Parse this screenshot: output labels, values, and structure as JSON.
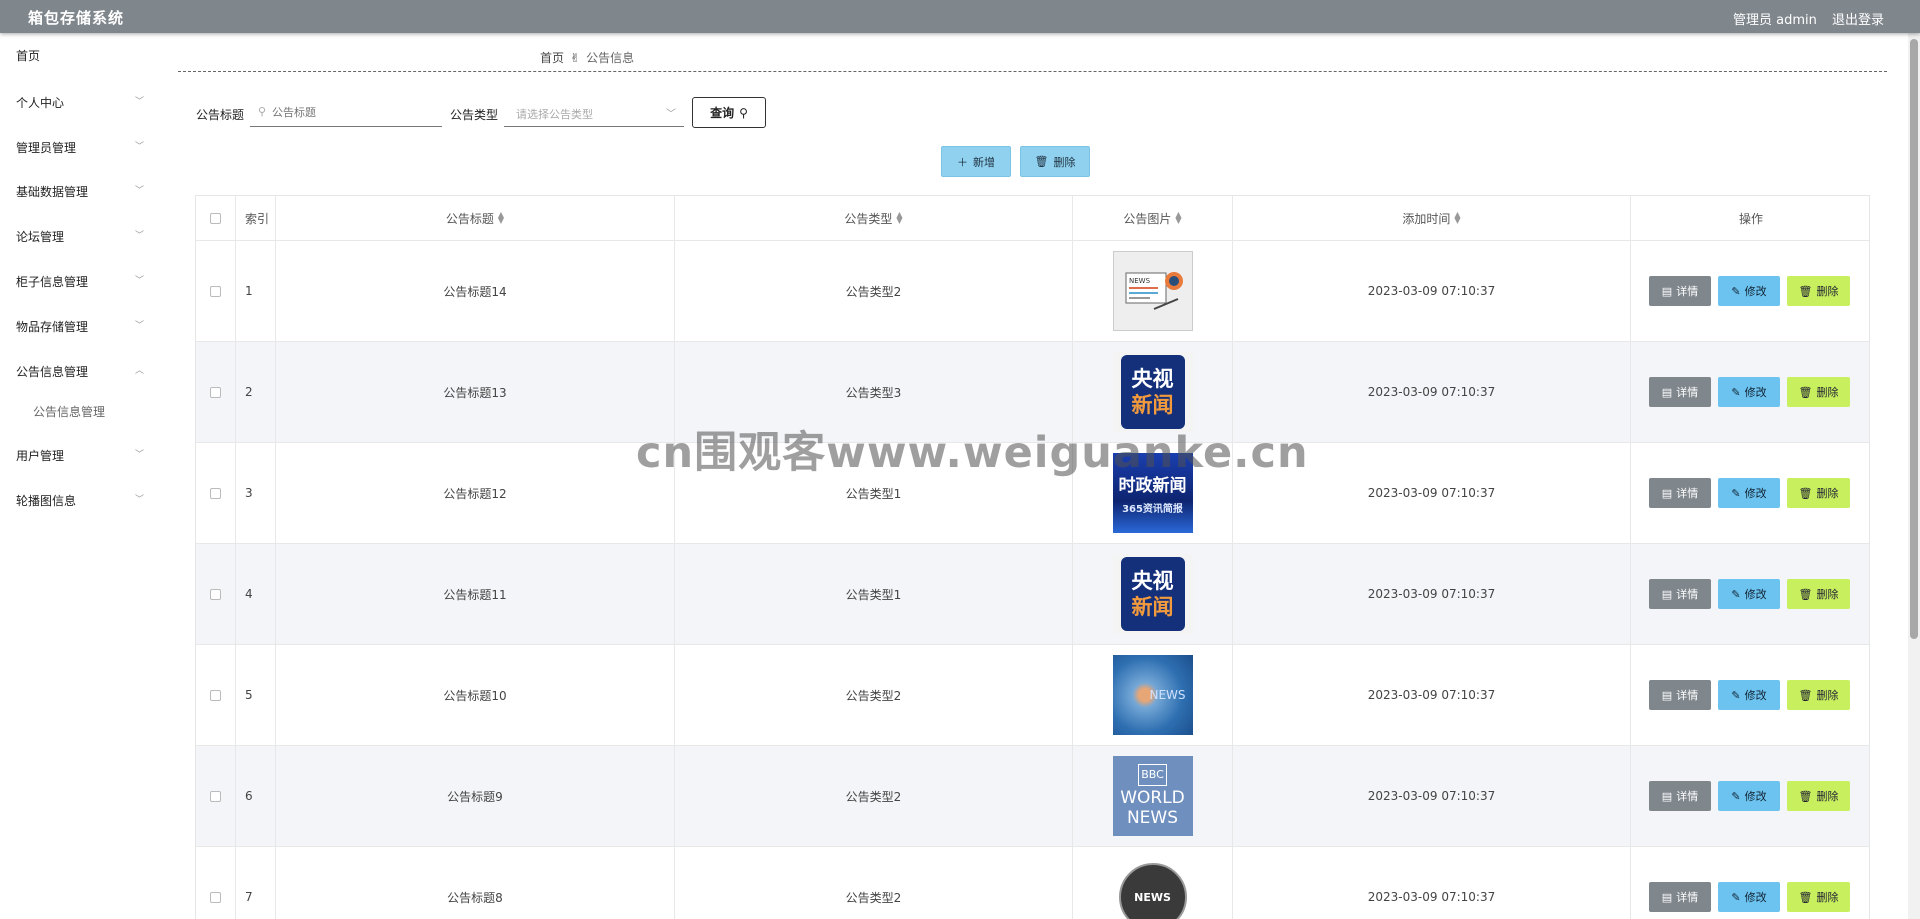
{
  "header": {
    "app_title": "箱包存储系统",
    "user_label": "管理员 admin",
    "logout_label": "退出登录"
  },
  "sidebar": {
    "items": [
      {
        "label": "首页",
        "has_chevron": false
      },
      {
        "label": "个人中心",
        "has_chevron": true
      },
      {
        "label": "管理员管理",
        "has_chevron": true
      },
      {
        "label": "基础数据管理",
        "has_chevron": true
      },
      {
        "label": "论坛管理",
        "has_chevron": true
      },
      {
        "label": "柜子信息管理",
        "has_chevron": true
      },
      {
        "label": "物品存储管理",
        "has_chevron": true
      },
      {
        "label": "公告信息管理",
        "has_chevron": true,
        "expanded": true
      },
      {
        "label": "用户管理",
        "has_chevron": true
      },
      {
        "label": "轮播图信息",
        "has_chevron": true
      }
    ],
    "subitem": "公告信息管理"
  },
  "breadcrumb": {
    "home": "首页",
    "current": "公告信息"
  },
  "search": {
    "title_label": "公告标题",
    "title_placeholder": "公告标题",
    "type_label": "公告类型",
    "type_placeholder": "请选择公告类型",
    "query_label": "查询"
  },
  "actions": {
    "add_label": "新增",
    "delete_label": "删除"
  },
  "table": {
    "columns": {
      "index": "索引",
      "title": "公告标题",
      "type": "公告类型",
      "image": "公告图片",
      "time": "添加时间",
      "ops": "操作"
    },
    "rows": [
      {
        "index": "1",
        "title": "公告标题14",
        "type": "公告类型2",
        "image": "news-paper-thumb",
        "time": "2023-03-09 07:10:37"
      },
      {
        "index": "2",
        "title": "公告标题13",
        "type": "公告类型3",
        "image": "cctv-news-thumb",
        "time": "2023-03-09 07:10:37"
      },
      {
        "index": "3",
        "title": "公告标题12",
        "type": "公告类型1",
        "image": "shizheng-news-thumb",
        "time": "2023-03-09 07:10:37"
      },
      {
        "index": "4",
        "title": "公告标题11",
        "type": "公告类型1",
        "image": "cctv-news-thumb",
        "time": "2023-03-09 07:10:37"
      },
      {
        "index": "5",
        "title": "公告标题10",
        "type": "公告类型2",
        "image": "blue-news-thumb",
        "time": "2023-03-09 07:10:37"
      },
      {
        "index": "6",
        "title": "公告标题9",
        "type": "公告类型2",
        "image": "bbc-world-news-thumb",
        "time": "2023-03-09 07:10:37"
      },
      {
        "index": "7",
        "title": "公告标题8",
        "type": "公告类型2",
        "image": "globe-news-thumb",
        "time": "2023-03-09 07:10:37"
      }
    ],
    "op_labels": {
      "detail": "详情",
      "edit": "修改",
      "delete": "删除"
    }
  },
  "thumb_text": {
    "cctv_top": "央视",
    "cctv_bottom": "新闻",
    "shizheng_main": "时政新闻",
    "shizheng_sub": "365资讯简报",
    "blue_news": "NEWS",
    "bbc_logo": "BBC",
    "bbc_world": "WORLD",
    "bbc_news": "NEWS",
    "globe_news": "NEWS",
    "paper_news": "NEWS"
  },
  "watermark": "cn围观客www.weiguanke.cn",
  "colors": {
    "topbar": "#7f868c",
    "detail_btn": "#7f868c",
    "edit_btn": "#6cc3ef",
    "delete_btn": "#c7ef5e",
    "action_btn": "#8fd1ee"
  }
}
